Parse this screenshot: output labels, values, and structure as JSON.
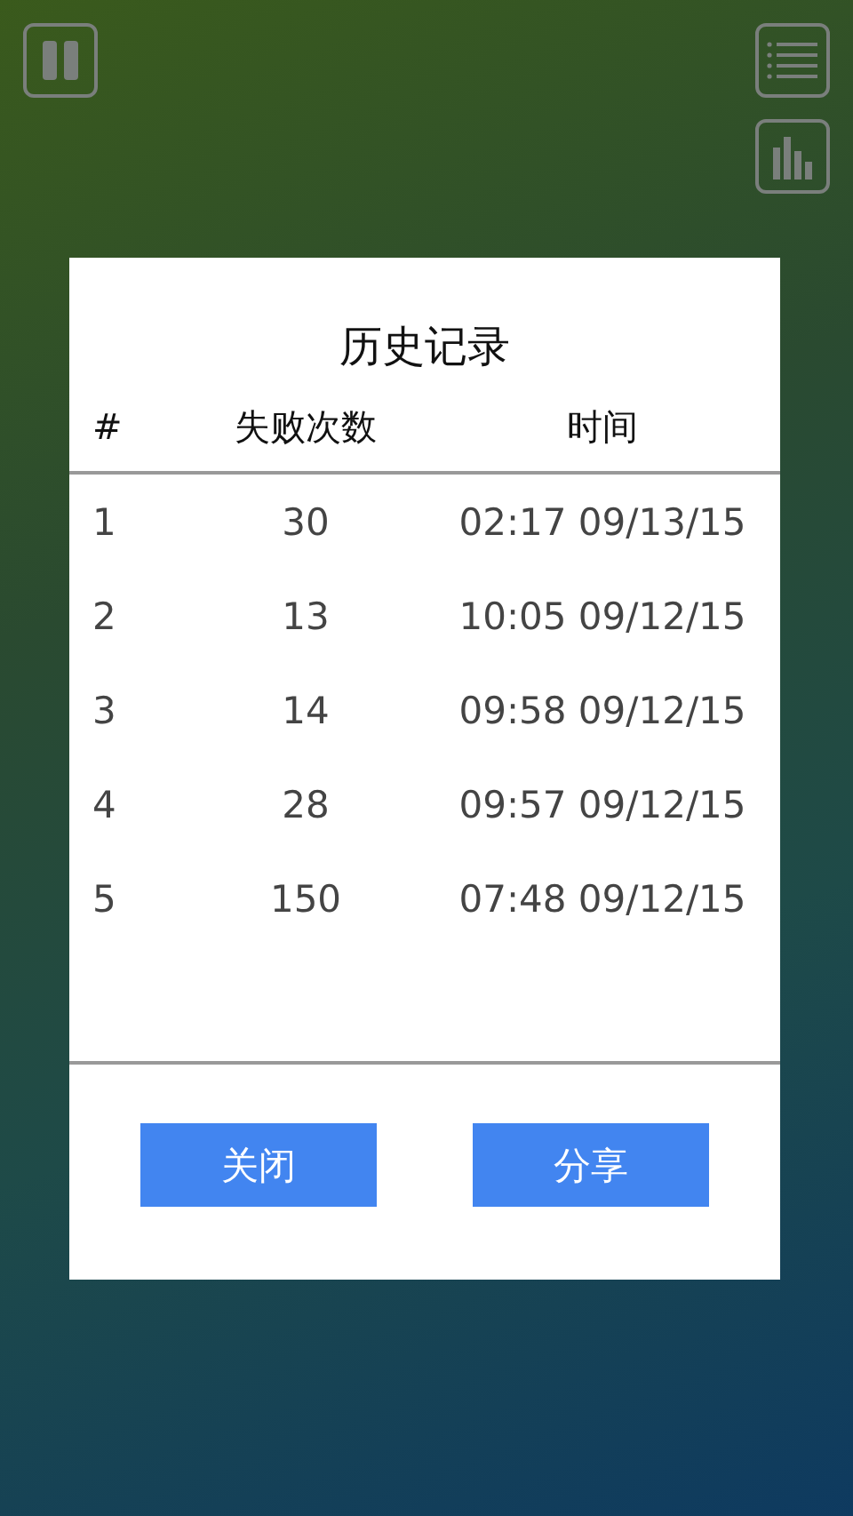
{
  "toolbar": {
    "left": [
      {
        "kind": "pause"
      }
    ],
    "right": [
      {
        "kind": "list"
      },
      {
        "kind": "chart"
      }
    ]
  },
  "dialog": {
    "title": "历史记录",
    "columns": [
      "#",
      "失败次数",
      "时间"
    ],
    "rows": [
      {
        "index": "1",
        "failures": "30",
        "time": "02:17 09/13/15"
      },
      {
        "index": "2",
        "failures": "13",
        "time": "10:05 09/12/15"
      },
      {
        "index": "3",
        "failures": "14",
        "time": "09:58 09/12/15"
      },
      {
        "index": "4",
        "failures": "28",
        "time": "09:57 09/12/15"
      },
      {
        "index": "5",
        "failures": "150",
        "time": "07:48 09/12/15"
      }
    ],
    "buttons": [
      "关闭",
      "分享"
    ]
  }
}
